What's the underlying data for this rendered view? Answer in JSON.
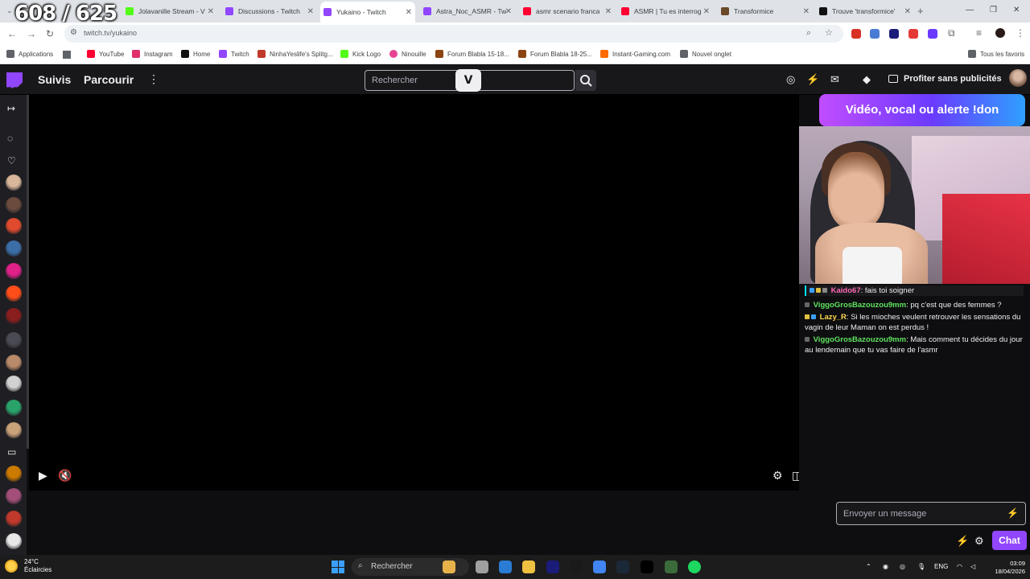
{
  "overlay_counter": "608 / 625",
  "browser": {
    "tabs": [
      {
        "label": "Jolavanille Stream - V",
        "color": "#53fc18"
      },
      {
        "label": "Discussions - Twitch",
        "color": "#9146ff"
      },
      {
        "label": "Yukaino - Twitch",
        "color": "#9146ff",
        "active": true
      },
      {
        "label": "Astra_Noc_ASMR - Tw",
        "color": "#9146ff"
      },
      {
        "label": "asmr scenario franca",
        "color": "#ff0033"
      },
      {
        "label": "ASMR | Tu es interrog",
        "color": "#ff0033"
      },
      {
        "label": "Transformice",
        "color": "#6b4a2a"
      },
      {
        "label": "Trouve 'transformice'",
        "color": "#111111"
      }
    ],
    "url": "twitch.tv/yukaino",
    "bookmarks": [
      {
        "label": "Applications",
        "color": "#5f6368"
      },
      {
        "label": "YouTube",
        "color": "#ff0033"
      },
      {
        "label": "Instagram",
        "color": "#e1306c"
      },
      {
        "label": "Home",
        "color": "#111111"
      },
      {
        "label": "Twitch",
        "color": "#9146ff"
      },
      {
        "label": "NinhaYeslife's Splitg...",
        "color": "#c0392b"
      },
      {
        "label": "Kick Logo",
        "color": "#53fc18"
      },
      {
        "label": "Ninouille",
        "color": "#e84393"
      },
      {
        "label": "Forum Blabla 15-18...",
        "color": "#8b4513"
      },
      {
        "label": "Forum Blabla 18-25...",
        "color": "#8b4513"
      },
      {
        "label": "Instant-Gaming.com",
        "color": "#ff6a00"
      },
      {
        "label": "Nouvel onglet",
        "color": "#5f6368"
      }
    ],
    "all_bookmarks": "Tous les favoris"
  },
  "twitch": {
    "nav_following": "Suivis",
    "nav_browse": "Parcourir",
    "search_placeholder": "Rechercher",
    "overlay_logo": "V",
    "promo": "Profiter sans publicités",
    "alert_banner": "Vidéo, vocal ou alerte !don",
    "chat_messages": [
      {
        "user": "Kaido67",
        "color": "#ff69b4",
        "text": "fais toi soigner"
      },
      {
        "user": "ViggoGrosBazouzou9mm",
        "color": "#5fe35f",
        "text": "pq c'est que des femmes ?"
      },
      {
        "user": "Lazy_R",
        "color": "#ffd84d",
        "text": "Si les mioches veulent retrouver les sensations du vagin de leur Maman on est perdus !"
      },
      {
        "user": "ViggoGrosBazouzou9mm",
        "color": "#5fe35f",
        "text": "Mais comment tu décides du jour au lendemain que tu vas faire de l'asmr"
      }
    ],
    "message_placeholder": "Envoyer un message",
    "chat_button": "Chat",
    "sidebar_avatars": [
      "#d8b79a",
      "#6b4b3e",
      "#e04a2f",
      "#3c6fa8",
      "#e0218a",
      "#ff4d1a",
      "#8a1d1d",
      "#4a4a52",
      "#b98b6a",
      "#d1d1d1",
      "#2aa36b",
      "#c9a27a",
      "#cc7a00",
      "#a34f7a",
      "#c0392b",
      "#e8e8e8"
    ]
  },
  "taskbar": {
    "temp": "24°C",
    "weather": "Éclaircies",
    "search": "Rechercher",
    "apps": [
      "#e8b24a",
      "#a0a0a0",
      "#2a7bd4",
      "#f0c040",
      "#1b1b7a",
      "#1a1a1a",
      "#4285f4",
      "#1b2838",
      "#000000",
      "#3b6a3b",
      "#1ed760"
    ],
    "lang": "ENG",
    "time": "03:09",
    "date": "18/04/2026"
  }
}
